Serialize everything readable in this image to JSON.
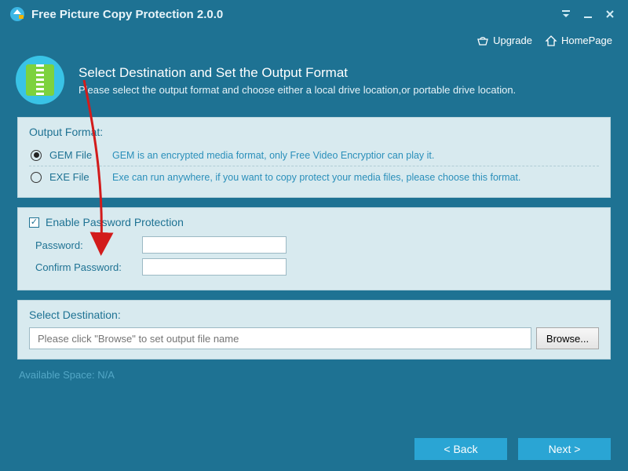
{
  "title": "Free Picture Copy Protection 2.0.0",
  "toplinks": {
    "upgrade": "Upgrade",
    "homepage": "HomePage"
  },
  "heading": {
    "title": "Select Destination and Set the Output Format",
    "subtitle": "Please select the output format and choose either a local drive location,or portable drive location."
  },
  "output": {
    "section": "Output Format:",
    "options": [
      {
        "label": "GEM File",
        "desc": "GEM is an encrypted media format, only Free Video Encryptior can play it.",
        "checked": true
      },
      {
        "label": "EXE File",
        "desc": "Exe can run anywhere, if you want to copy protect your media files, please choose this format.",
        "checked": false
      }
    ]
  },
  "password": {
    "enable": "Enable Password Protection",
    "password_label": "Password:",
    "confirm_label": "Confirm Password:",
    "password_value": "",
    "confirm_value": ""
  },
  "destination": {
    "section": "Select Destination:",
    "placeholder": "Please click \"Browse\" to set output file name",
    "browse": "Browse...",
    "available": "Available Space: N/A"
  },
  "footer": {
    "back": "< Back",
    "next": "Next >"
  }
}
